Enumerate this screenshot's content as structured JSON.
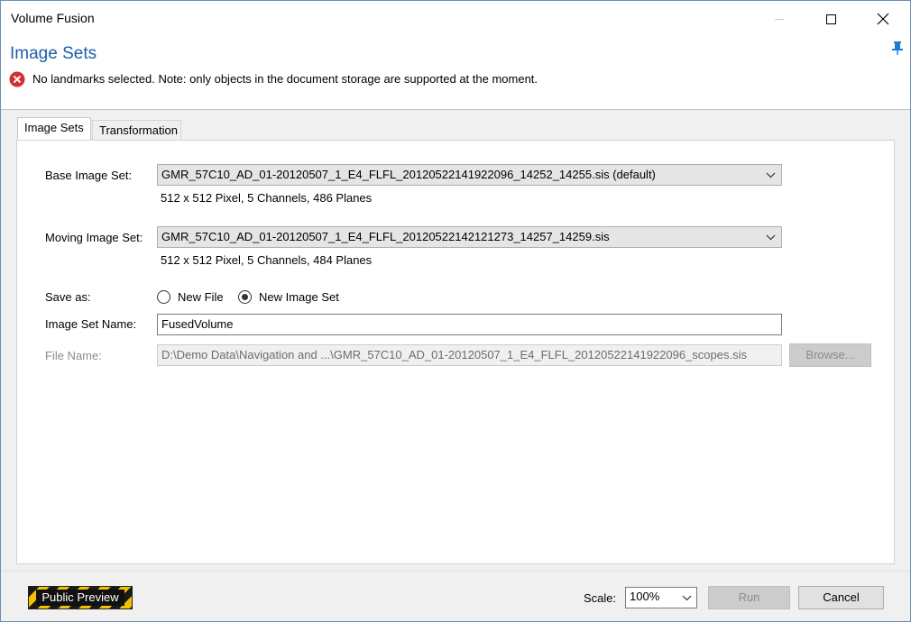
{
  "window": {
    "title": "Volume Fusion"
  },
  "header": {
    "title": "Image Sets",
    "error_message": "No landmarks selected. Note: only objects in the document storage are supported at the moment."
  },
  "tabs": [
    {
      "label": "Image Sets",
      "active": true
    },
    {
      "label": "Transformation",
      "active": false
    }
  ],
  "form": {
    "base_label": "Base Image Set:",
    "base_value": "GMR_57C10_AD_01-20120507_1_E4_FLFL_20120522141922096_14252_14255.sis (default)",
    "base_info": "512 x 512 Pixel, 5 Channels, 486 Planes",
    "moving_label": "Moving Image Set:",
    "moving_value": "GMR_57C10_AD_01-20120507_1_E4_FLFL_20120522142121273_14257_14259.sis",
    "moving_info": "512 x 512 Pixel, 5 Channels, 484 Planes",
    "save_as_label": "Save as:",
    "option_new_file": "New File",
    "option_new_image_set": "New Image Set",
    "selected_option": "New Image Set",
    "image_set_name_label": "Image Set Name:",
    "image_set_name_value": "FusedVolume",
    "file_name_label": "File Name:",
    "file_name_value": "D:\\Demo Data\\Navigation and ...\\GMR_57C10_AD_01-20120507_1_E4_FLFL_20120522141922096_scopes.sis",
    "browse_label": "Browse..."
  },
  "footer": {
    "preview_badge": "Public Preview",
    "scale_label": "Scale:",
    "scale_value": "100%",
    "run_label": "Run",
    "cancel_label": "Cancel"
  },
  "colors": {
    "header_title": "#1c5fa8",
    "error_icon": "#d32f2f",
    "badge_stripe_yellow": "#f2c200",
    "body_background": "#f0f0f0"
  }
}
